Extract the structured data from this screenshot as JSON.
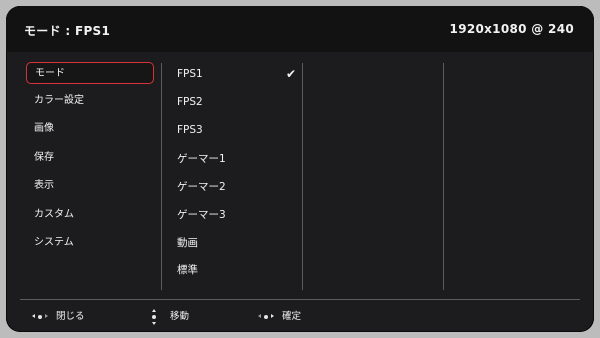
{
  "header": {
    "title": "モード : FPS1",
    "resolution": "1920x1080 @ 240"
  },
  "left_menu": {
    "items": [
      {
        "label": "モード",
        "selected": true
      },
      {
        "label": "カラー設定",
        "selected": false
      },
      {
        "label": "画像",
        "selected": false
      },
      {
        "label": "保存",
        "selected": false
      },
      {
        "label": "表示",
        "selected": false
      },
      {
        "label": "カスタム",
        "selected": false
      },
      {
        "label": "システム",
        "selected": false
      }
    ]
  },
  "mode_menu": {
    "items": [
      {
        "label": "FPS1",
        "checked": true
      },
      {
        "label": "FPS2",
        "checked": false
      },
      {
        "label": "FPS3",
        "checked": false
      },
      {
        "label": "ゲーマー1",
        "checked": false
      },
      {
        "label": "ゲーマー2",
        "checked": false
      },
      {
        "label": "ゲーマー3",
        "checked": false
      },
      {
        "label": "動画",
        "checked": false
      },
      {
        "label": "標準",
        "checked": false
      }
    ],
    "check_glyph": "✔"
  },
  "footer": {
    "close_label": "閉じる",
    "move_label": "移動",
    "confirm_label": "確定"
  },
  "colors": {
    "selection_border": "#d8323a",
    "panel_background": "#1c1c1e",
    "header_background": "#121213",
    "text": "#f2f2f2"
  },
  "icons": {
    "close": "jog-left-icon",
    "move": "jog-up-down-icon",
    "confirm": "jog-right-icon"
  }
}
